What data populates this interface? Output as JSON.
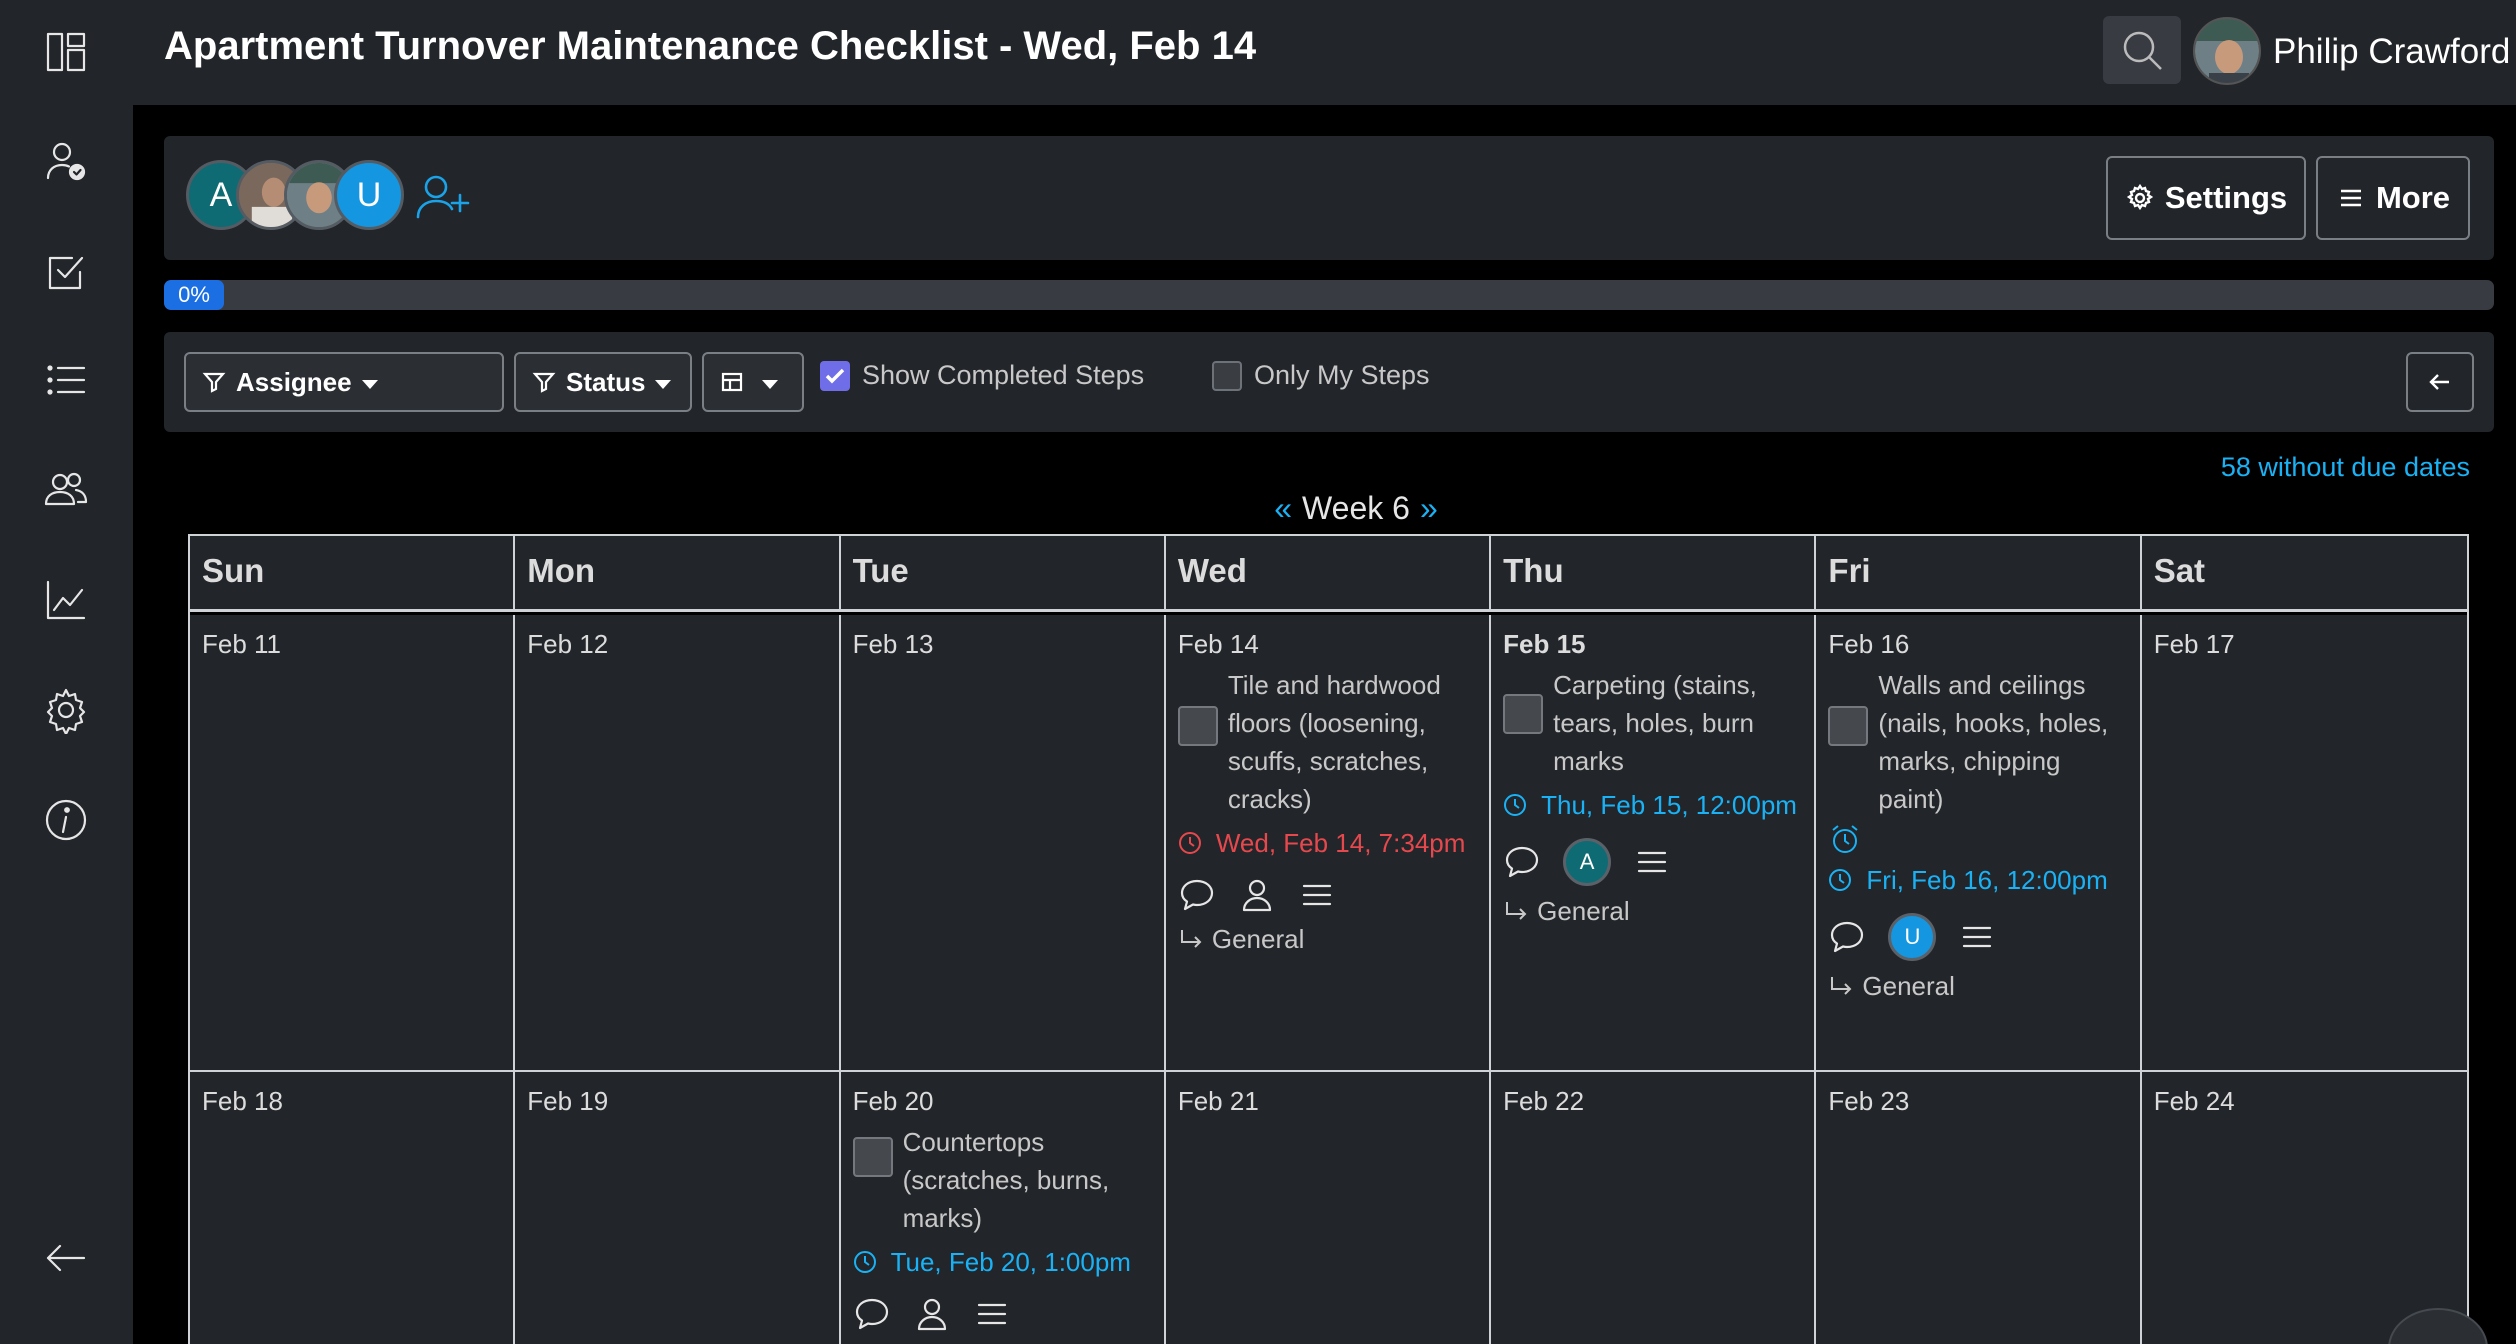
{
  "header": {
    "title": "Apartment Turnover Maintenance Checklist - Wed, Feb 14",
    "user_name": "Philip Crawford"
  },
  "sidebar": {
    "items": [
      {
        "name": "dashboard-icon"
      },
      {
        "name": "my-assignments-icon"
      },
      {
        "name": "checklists-icon"
      },
      {
        "name": "list-icon"
      },
      {
        "name": "users-icon"
      },
      {
        "name": "reports-icon"
      },
      {
        "name": "settings-icon"
      },
      {
        "name": "info-icon"
      },
      {
        "name": "collapse-arrow-icon"
      }
    ]
  },
  "members": [
    {
      "initial": "A",
      "color": "#0e6b73",
      "type": "initial"
    },
    {
      "initial": "",
      "color": "#8a6f64",
      "type": "photo"
    },
    {
      "initial": "",
      "color": "#6b8a7a",
      "type": "photo"
    },
    {
      "initial": "U",
      "color": "#1596e0",
      "type": "initial"
    }
  ],
  "buttons": {
    "settings": "Settings",
    "more": "More"
  },
  "progress": {
    "value": 0,
    "label": "0%"
  },
  "filters": {
    "assignee": "Assignee",
    "status": "Status",
    "show_completed": {
      "label": "Show Completed Steps",
      "checked": true
    },
    "only_mine": {
      "label": "Only My Steps",
      "checked": false
    }
  },
  "calendar": {
    "without_due": "58 without due dates",
    "week_label": "Week 6",
    "prev": "«",
    "next": "»",
    "days": [
      "Sun",
      "Mon",
      "Tue",
      "Wed",
      "Thu",
      "Fri",
      "Sat"
    ],
    "week1": [
      "Feb 11",
      "Feb 12",
      "Feb 13",
      "Feb 14",
      "Feb 15",
      "Feb 16",
      "Feb 17"
    ],
    "week2": [
      "Feb 18",
      "Feb 19",
      "Feb 20",
      "Feb 21",
      "Feb 22",
      "Feb 23",
      "Feb 24"
    ],
    "tasks": {
      "wed": {
        "name": "Tile and hardwood floors (loosening, scuffs, scratches, cracks)",
        "due": "Wed, Feb 14, 7:34pm",
        "group": "General"
      },
      "thu": {
        "name": "Carpeting (stains, tears, holes, burn marks",
        "due": "Thu, Feb 15, 12:00pm",
        "assignee": "A",
        "group": "General"
      },
      "fri": {
        "name": "Walls and ceilings (nails, hooks, holes, marks, chipping paint)",
        "due": "Fri, Feb 16, 12:00pm",
        "assignee": "U",
        "group": "General"
      },
      "tue2": {
        "name": "Countertops (scratches, burns, marks)",
        "due": "Tue, Feb 20, 1:00pm"
      }
    }
  }
}
